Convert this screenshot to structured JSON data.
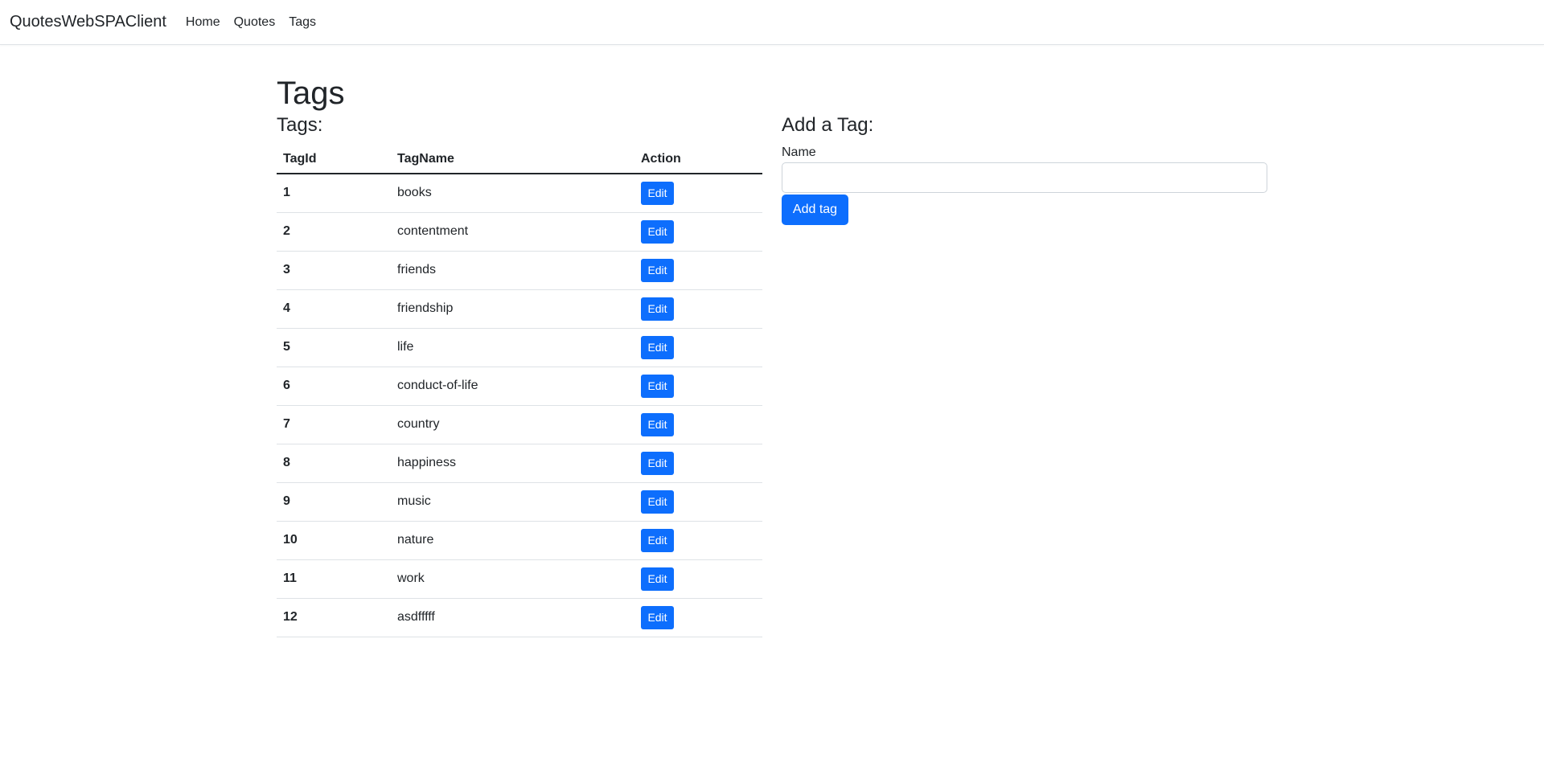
{
  "navbar": {
    "brand": "QuotesWebSPAClient",
    "links": [
      "Home",
      "Quotes",
      "Tags"
    ]
  },
  "page": {
    "title": "Tags"
  },
  "tags_section": {
    "title": "Tags:",
    "columns": [
      "TagId",
      "TagName",
      "Action"
    ],
    "edit_label": "Edit",
    "rows": [
      {
        "id": "1",
        "name": "books"
      },
      {
        "id": "2",
        "name": "contentment"
      },
      {
        "id": "3",
        "name": "friends"
      },
      {
        "id": "4",
        "name": "friendship"
      },
      {
        "id": "5",
        "name": "life"
      },
      {
        "id": "6",
        "name": "conduct-of-life"
      },
      {
        "id": "7",
        "name": "country"
      },
      {
        "id": "8",
        "name": "happiness"
      },
      {
        "id": "9",
        "name": "music"
      },
      {
        "id": "10",
        "name": "nature"
      },
      {
        "id": "11",
        "name": "work"
      },
      {
        "id": "12",
        "name": "asdfffff"
      }
    ]
  },
  "add_section": {
    "title": "Add a Tag:",
    "name_label": "Name",
    "name_value": "",
    "submit_label": "Add tag"
  },
  "colors": {
    "primary": "#0d6efd",
    "text": "#212529",
    "border": "#dee2e6"
  }
}
